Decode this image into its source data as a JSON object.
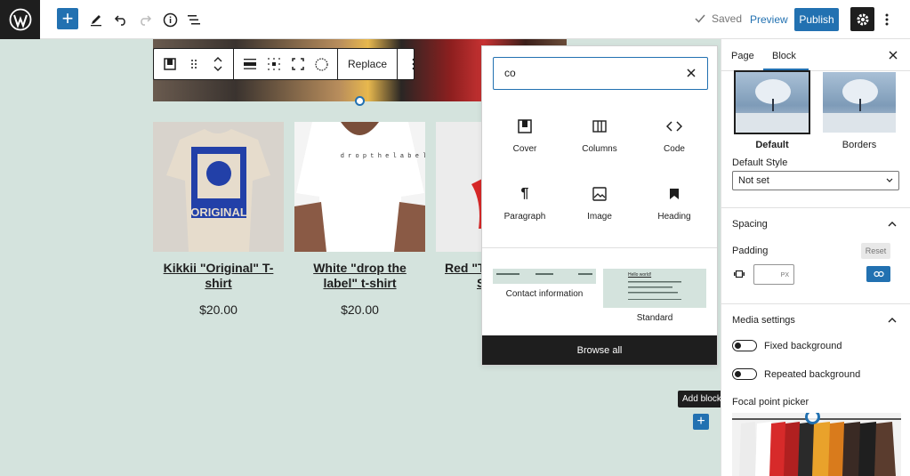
{
  "topbar": {
    "saved_label": "Saved",
    "preview_label": "Preview",
    "publish_label": "Publish"
  },
  "block_toolbar": {
    "replace_label": "Replace"
  },
  "products": [
    {
      "title": "Kikkii \"Original\" T-shirt",
      "price": "$20.00"
    },
    {
      "title": "White \"drop the label\" t-shirt",
      "price": "$20.00"
    },
    {
      "title": "Red \"T",
      "title_line2": "S",
      "price": ""
    }
  ],
  "product_shirt_print_1": "ORIGINAL",
  "product_shirt_print_2": "d r o p t h e l a b e l",
  "inserter": {
    "search_value": "co",
    "blocks": [
      {
        "label": "Cover",
        "icon": "cover-icon"
      },
      {
        "label": "Columns",
        "icon": "columns-icon"
      },
      {
        "label": "Code",
        "icon": "code-icon"
      },
      {
        "label": "Paragraph",
        "icon": "paragraph-icon"
      },
      {
        "label": "Image",
        "icon": "image-icon"
      },
      {
        "label": "Heading",
        "icon": "heading-icon"
      }
    ],
    "patterns": [
      {
        "label": "Contact information"
      },
      {
        "label": "Standard",
        "thumb_text": "Hello world!"
      }
    ],
    "browse_all_label": "Browse all"
  },
  "add_block": {
    "tooltip": "Add block"
  },
  "sidebar": {
    "tabs": [
      {
        "label": "Page"
      },
      {
        "label": "Block"
      }
    ],
    "styles": [
      {
        "label": "Default"
      },
      {
        "label": "Borders"
      }
    ],
    "default_style_label": "Default Style",
    "default_style_value": "Not set",
    "spacing_title": "Spacing",
    "padding_label": "Padding",
    "reset_label": "Reset",
    "padding_unit": "PX",
    "media_title": "Media settings",
    "fixed_bg_label": "Fixed background",
    "repeated_bg_label": "Repeated background",
    "focal_label": "Focal point picker"
  },
  "colors": {
    "accent": "#2271b1",
    "canvas": "#d4e3dd",
    "dark": "#1e1e1e"
  }
}
